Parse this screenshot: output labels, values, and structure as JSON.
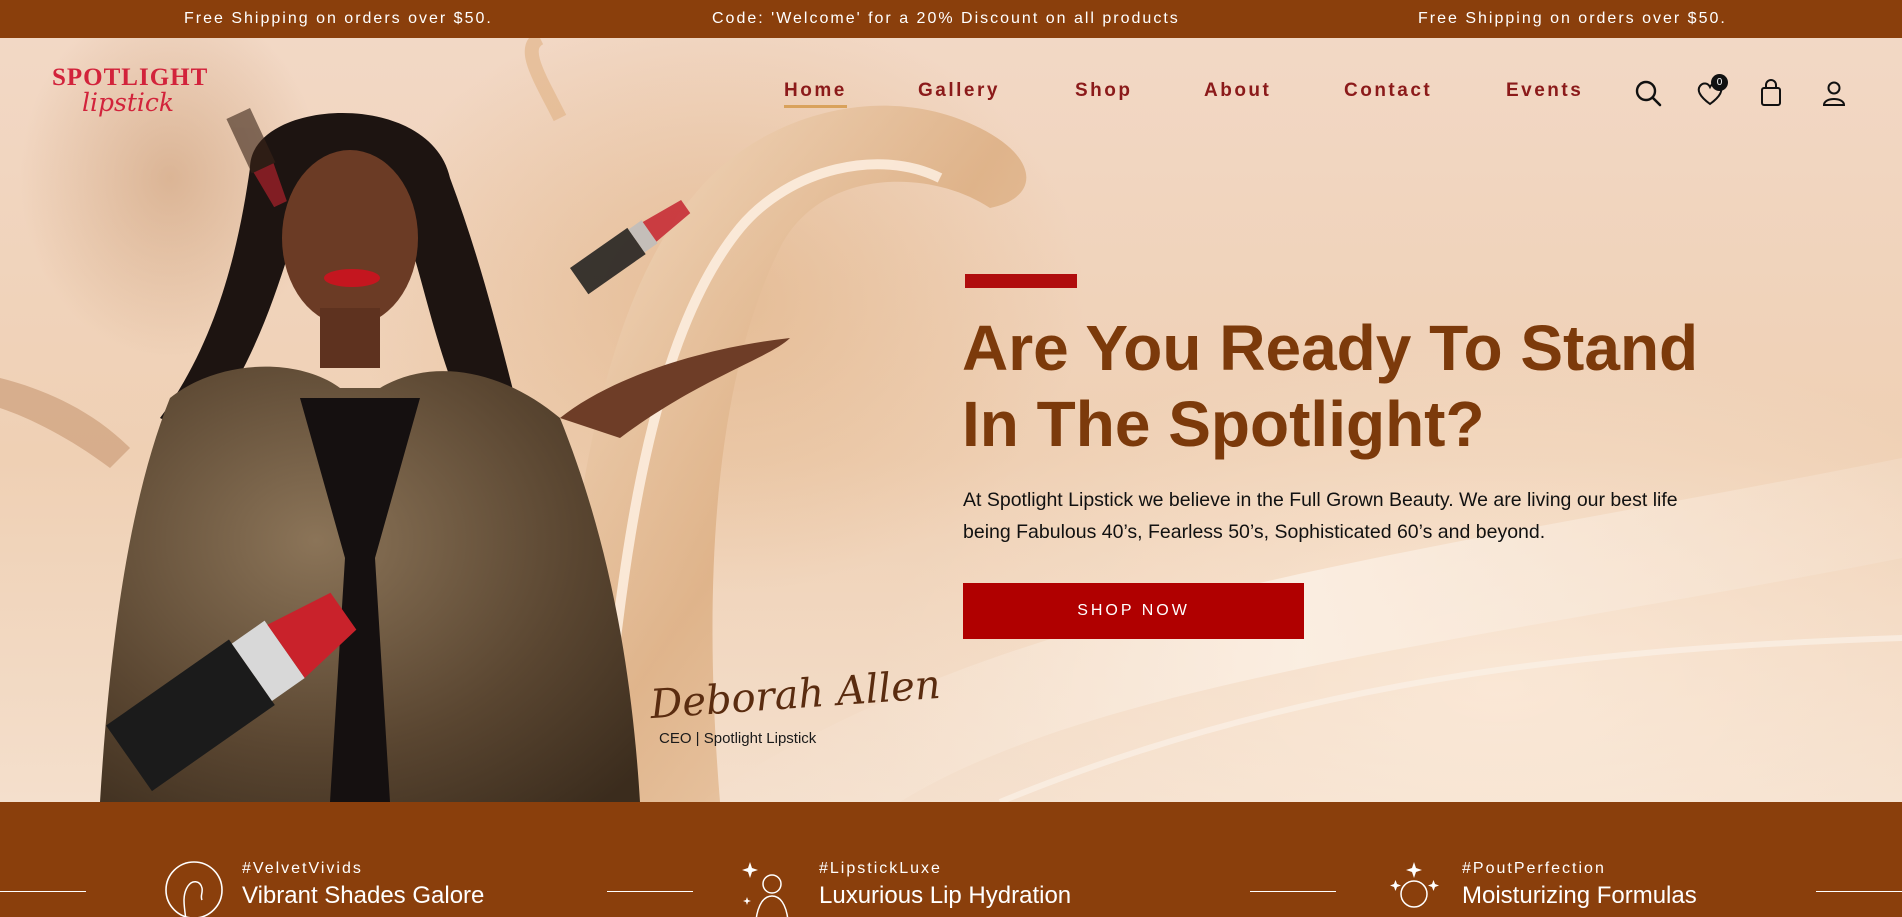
{
  "announcements": [
    "Free Shipping on orders over $50.",
    "Code: 'Welcome' for a 20% Discount on all products",
    "Free Shipping on orders over $50."
  ],
  "logo": {
    "line1": "SPOTLIGHT",
    "line2": "lipstick"
  },
  "nav": {
    "items": [
      "Home",
      "Gallery",
      "Shop",
      "About",
      "Contact",
      "Events"
    ],
    "active": "Home"
  },
  "header_icons": {
    "search": "search-icon",
    "wishlist": "heart-icon",
    "wishlist_count": "0",
    "cart": "shopping-bag-icon",
    "account": "user-icon"
  },
  "hero": {
    "headline_line1": "Are You Ready To Stand",
    "headline_line2": "In The Spotlight?",
    "lead_line1": "At Spotlight Lipstick we believe in the Full Grown Beauty. We are living our best life",
    "lead_line2": "being Fabulous 40’s, Fearless 50’s, Sophisticated 60’s and beyond.",
    "cta": "SHOP NOW",
    "signature": "Deborah Allen",
    "signature_title": "CEO | Spotlight Lipstick"
  },
  "features": [
    {
      "tag": "#VelvetVivids",
      "title": "Vibrant Shades Galore",
      "icon": "woman-profile-icon"
    },
    {
      "tag": "#LipstickLuxe",
      "title": "Luxurious Lip Hydration",
      "icon": "sparkle-woman-icon"
    },
    {
      "tag": "#PoutPerfection",
      "title": "Moisturizing Formulas",
      "icon": "face-glow-icon"
    }
  ],
  "colors": {
    "brand_brown": "#8a3f0c",
    "headline_brown": "#7c3a0b",
    "cta_red": "#b00000",
    "nav_red": "#8b1a1a",
    "logo_red": "#d2233b",
    "accent_gold": "#d9a25c"
  }
}
